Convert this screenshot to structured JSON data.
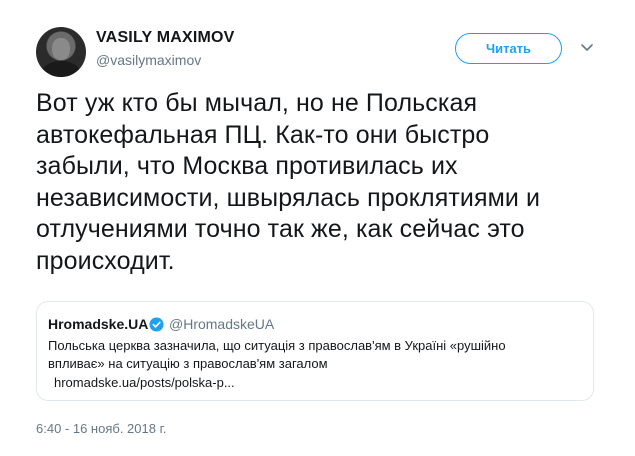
{
  "author": {
    "name": "VASILY MAXIMOV",
    "handle": "@vasilymaximov"
  },
  "follow_button": {
    "label": "Читать"
  },
  "tweet": {
    "lines": [
      "Вот уж кто бы мычал, но не Польская",
      "автокефальная ПЦ. Как-то они быстро",
      "забыли, что Москва противилась их",
      "независимости, швырялась проклятиями и",
      "отлучениями точно так же, как сейчас это",
      "происходит."
    ]
  },
  "quoted": {
    "name": "Hromadske.UA",
    "handle": "@HromadskeUA",
    "text_lines": [
      "Польська церква зазначила, що ситуація з православ'ям в Україні «рушійно",
      "впливає» на ситуацію з православ'ям загалом"
    ],
    "link": "hromadske.ua/posts/polska-p..."
  },
  "timestamp": "6:40 - 16 нояб. 2018 г.",
  "colors": {
    "accent": "#1da1f2",
    "secondary_text": "#657786",
    "border": "#e1e8ed"
  },
  "icons": {
    "menu": "chevron-down-icon",
    "verified": "verified-badge-icon"
  }
}
